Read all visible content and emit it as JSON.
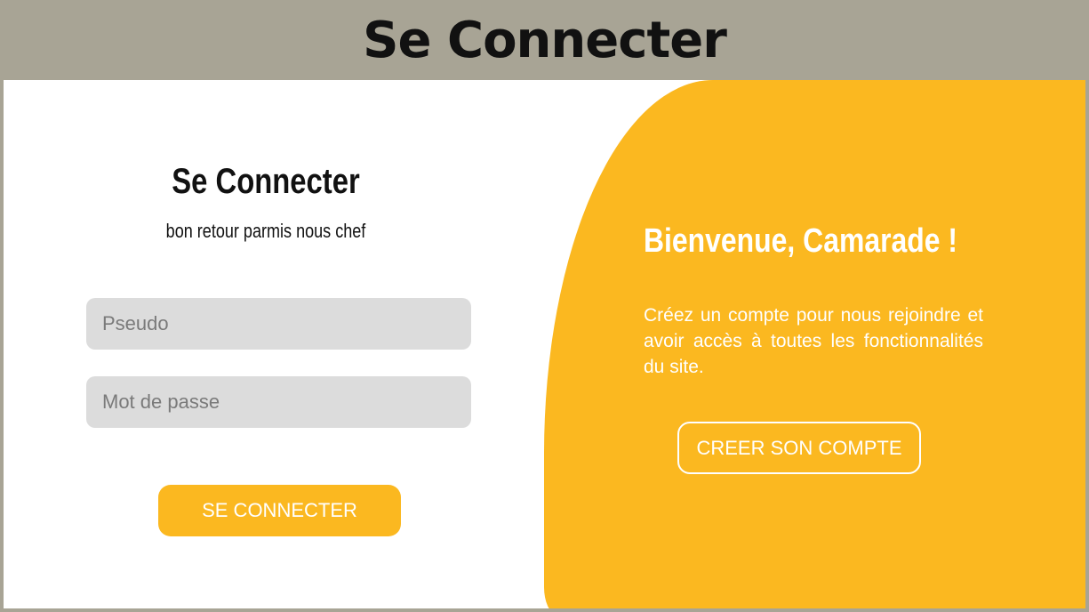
{
  "banner": {
    "title": "Se Connecter"
  },
  "login_form": {
    "title": "Se Connecter",
    "subtitle": "bon retour parmis nous chef",
    "pseudo_placeholder": "Pseudo",
    "password_placeholder": "Mot de passe",
    "submit_label": "SE CONNECTER"
  },
  "signup_panel": {
    "title": "Bienvenue, Camarade !",
    "text": "Créez un compte pour nous rejoindre et avoir accès à toutes les fonctionnalités du site.",
    "button_label": "CREER SON COMPTE"
  },
  "colors": {
    "banner_bg": "#a8a495",
    "accent": "#fbb820",
    "input_bg": "#dcdcdc",
    "text_dark": "#111111"
  }
}
